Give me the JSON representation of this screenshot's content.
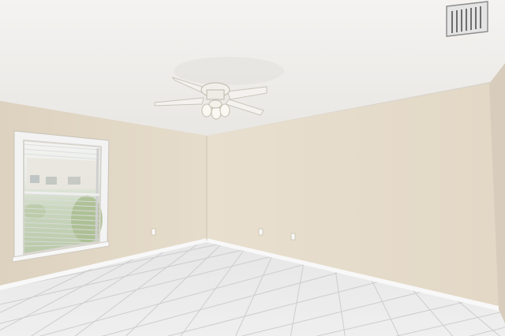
{
  "scene": {
    "watermark_text": "",
    "colors": {
      "ceiling": "#f0efec",
      "wall_left": "#e2d8c6",
      "wall_back": "#e7dccb",
      "wall_right": "#dcd2c2",
      "floor_tile": "#e9e9e9",
      "grout": "#cfcfcf",
      "baseboard": "#f6f6f6",
      "window_frame": "#f5f5f5"
    },
    "elements": {
      "ceiling_fan": "ceiling-fan",
      "vent": "air-vent",
      "window": "window-with-blinds",
      "outlets": [
        "electrical-outlet",
        "electrical-outlet",
        "electrical-outlet"
      ]
    }
  }
}
